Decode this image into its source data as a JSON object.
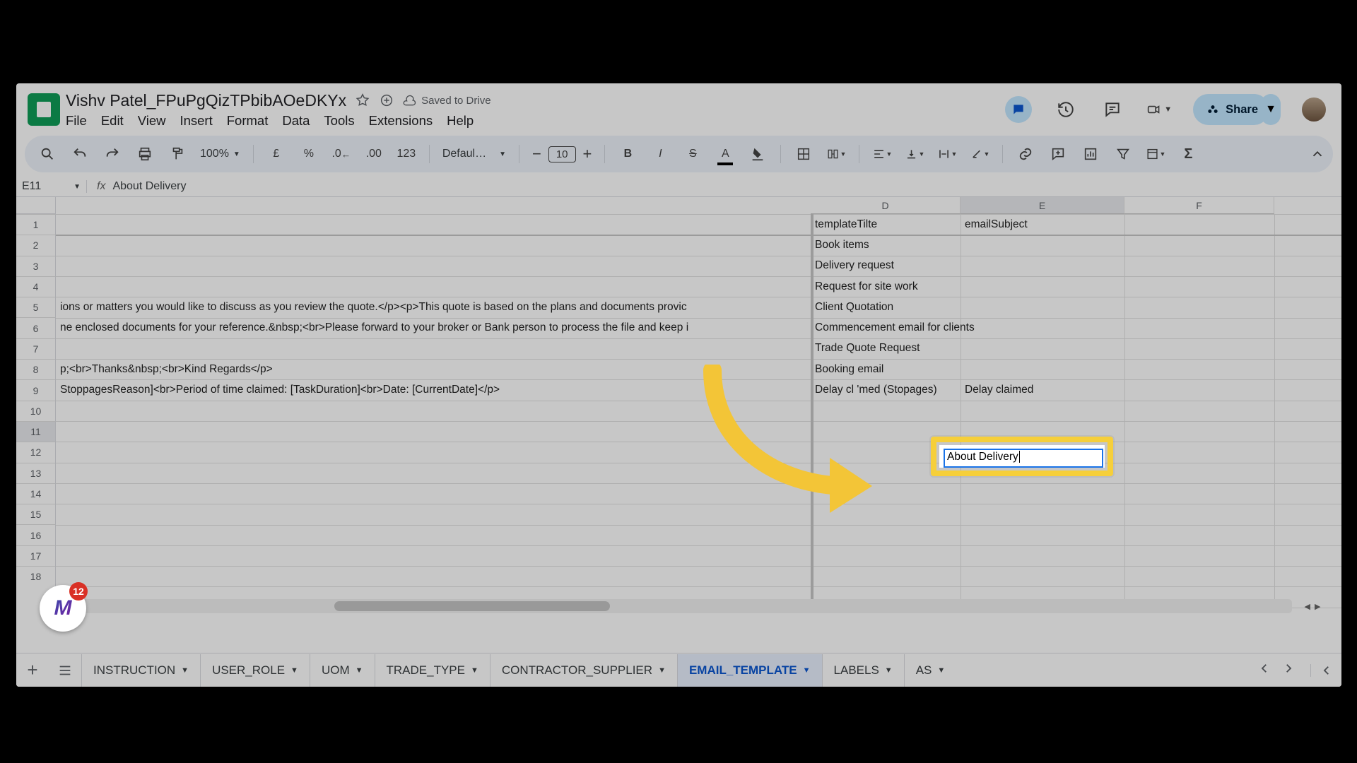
{
  "doc": {
    "title": "Vishv Patel_FPuPgQizTPbibAOeDKYx",
    "saved": "Saved to Drive"
  },
  "menus": {
    "file": "File",
    "edit": "Edit",
    "view": "View",
    "insert": "Insert",
    "format": "Format",
    "data": "Data",
    "tools": "Tools",
    "extensions": "Extensions",
    "help": "Help"
  },
  "share": "Share",
  "toolbar": {
    "zoom": "100%",
    "currency": "£",
    "percent": "%",
    "fmtnum": "123",
    "font": "Defaul…",
    "size": "10"
  },
  "namebox": "E11",
  "formula": "About Delivery",
  "cols": {
    "D": "D",
    "E": "E",
    "F": "F"
  },
  "headers": {
    "D": "templateTilte",
    "E": "emailSubject"
  },
  "rows": {
    "r2": {
      "D": "Book items"
    },
    "r3": {
      "D": "Delivery request"
    },
    "r4": {
      "D": "Request for site work"
    },
    "r5": {
      "C": "ions or matters you would like to discuss as you review the quote.</p><p>This quote is based on the plans and documents provic",
      "D": "Client Quotation"
    },
    "r6": {
      "C": "ne enclosed documents for your reference.&nbsp;<br>Please forward to your broker or Bank person to process the file and keep i",
      "D": "Commencement email for clients"
    },
    "r7": {
      "D": "Trade Quote Request"
    },
    "r8": {
      "C": "p;<br>Thanks&nbsp;<br>Kind Regards</p>",
      "D": "Booking email"
    },
    "r9": {
      "C": "StoppagesReason]<br>Period of time claimed: [TaskDuration]<br>Date: [CurrentDate]</p>",
      "D": "Delay cl   'med (Stopages)",
      "E": "Delay claimed"
    }
  },
  "editCell": "About Delivery",
  "tabs": [
    "INSTRUCTION",
    "USER_ROLE",
    "UOM",
    "TRADE_TYPE",
    "CONTRACTOR_SUPPLIER",
    "EMAIL_TEMPLATE",
    "LABELS",
    "AS"
  ],
  "activeTab": 5,
  "badgeCount": "12",
  "rowNums": [
    "1",
    "2",
    "3",
    "4",
    "5",
    "6",
    "7",
    "8",
    "9",
    "10",
    "11",
    "12",
    "13",
    "14",
    "15",
    "16",
    "17",
    "18"
  ]
}
